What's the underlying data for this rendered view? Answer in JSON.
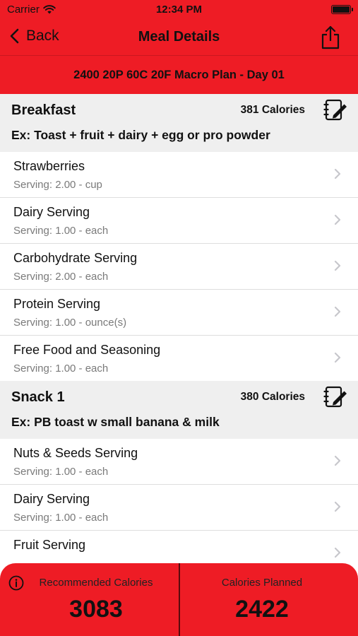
{
  "status": {
    "carrier": "Carrier",
    "time": "12:34 PM"
  },
  "nav": {
    "back_label": "Back",
    "title": "Meal Details"
  },
  "plan_title": "2400 20P 60C 20F Macro Plan - Day 01",
  "meals": [
    {
      "name": "Breakfast",
      "calories": "381 Calories",
      "example": "Ex: Toast + fruit + dairy + egg or pro powder",
      "items": [
        {
          "name": "Strawberries",
          "serving": "Serving: 2.00 - cup"
        },
        {
          "name": "Dairy Serving",
          "serving": "Serving: 1.00 - each"
        },
        {
          "name": "Carbohydrate Serving",
          "serving": "Serving: 2.00 - each"
        },
        {
          "name": "Protein Serving",
          "serving": "Serving: 1.00 - ounce(s)"
        },
        {
          "name": "Free Food and Seasoning",
          "serving": "Serving: 1.00 - each"
        }
      ]
    },
    {
      "name": "Snack 1",
      "calories": "380 Calories",
      "example": "Ex: PB toast w small banana & milk",
      "items": [
        {
          "name": "Nuts & Seeds Serving",
          "serving": "Serving: 1.00 - each"
        },
        {
          "name": "Dairy Serving",
          "serving": "Serving: 1.00 - each"
        },
        {
          "name": "Fruit Serving",
          "serving": ""
        }
      ]
    }
  ],
  "footer": {
    "recommended_label": "Recommended Calories",
    "recommended_value": "3083",
    "planned_label": "Calories Planned",
    "planned_value": "2422"
  },
  "icons": {
    "back": "chevron-left-icon",
    "share": "share-icon",
    "edit": "edit-note-icon",
    "chevron": "chevron-right-icon",
    "info": "info-icon",
    "wifi": "wifi-icon",
    "battery": "battery-icon"
  },
  "colors": {
    "accent": "#ee1c25",
    "section_bg": "#efefef",
    "secondary_text": "#7a7a7a"
  }
}
